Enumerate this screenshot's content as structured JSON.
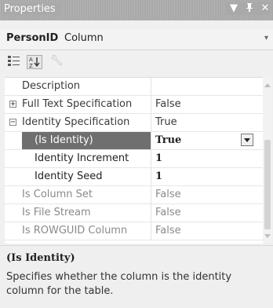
{
  "title": "Properties",
  "title_icons": [
    {
      "name": "dropdown-icon",
      "glyph": "▼"
    },
    {
      "name": "pin-icon",
      "glyph": "ᵽ"
    },
    {
      "name": "close-icon",
      "glyph": "✕"
    }
  ],
  "object": {
    "name": "PersonID",
    "type": "Column"
  },
  "toolbar": {
    "categorized_icon": "categorized-icon",
    "alphabetical_icon": "alphabetical-icon",
    "property_pages_icon": "wrench-icon"
  },
  "properties": [
    {
      "name": "Description",
      "value": "",
      "style": "normal"
    },
    {
      "name": "Full Text Specification",
      "value": "False",
      "style": "normal",
      "expander": "+"
    },
    {
      "name": "Identity Specification",
      "value": "True",
      "style": "normal",
      "expander": "−"
    },
    {
      "name": "(Is Identity)",
      "value": "True",
      "style": "bold sub selected",
      "dropdown": true
    },
    {
      "name": "Identity Increment",
      "value": "1",
      "style": "bold sub"
    },
    {
      "name": "Identity Seed",
      "value": "1",
      "style": "bold sub"
    },
    {
      "name": "Is Column Set",
      "value": "False",
      "style": "dim"
    },
    {
      "name": "Is File Stream",
      "value": "False",
      "style": "dim"
    },
    {
      "name": "Is ROWGUID Column",
      "value": "False",
      "style": "dim"
    }
  ],
  "description": {
    "title": "(Is Identity)",
    "text": "Specifies whether the column is the identity column for the table."
  }
}
